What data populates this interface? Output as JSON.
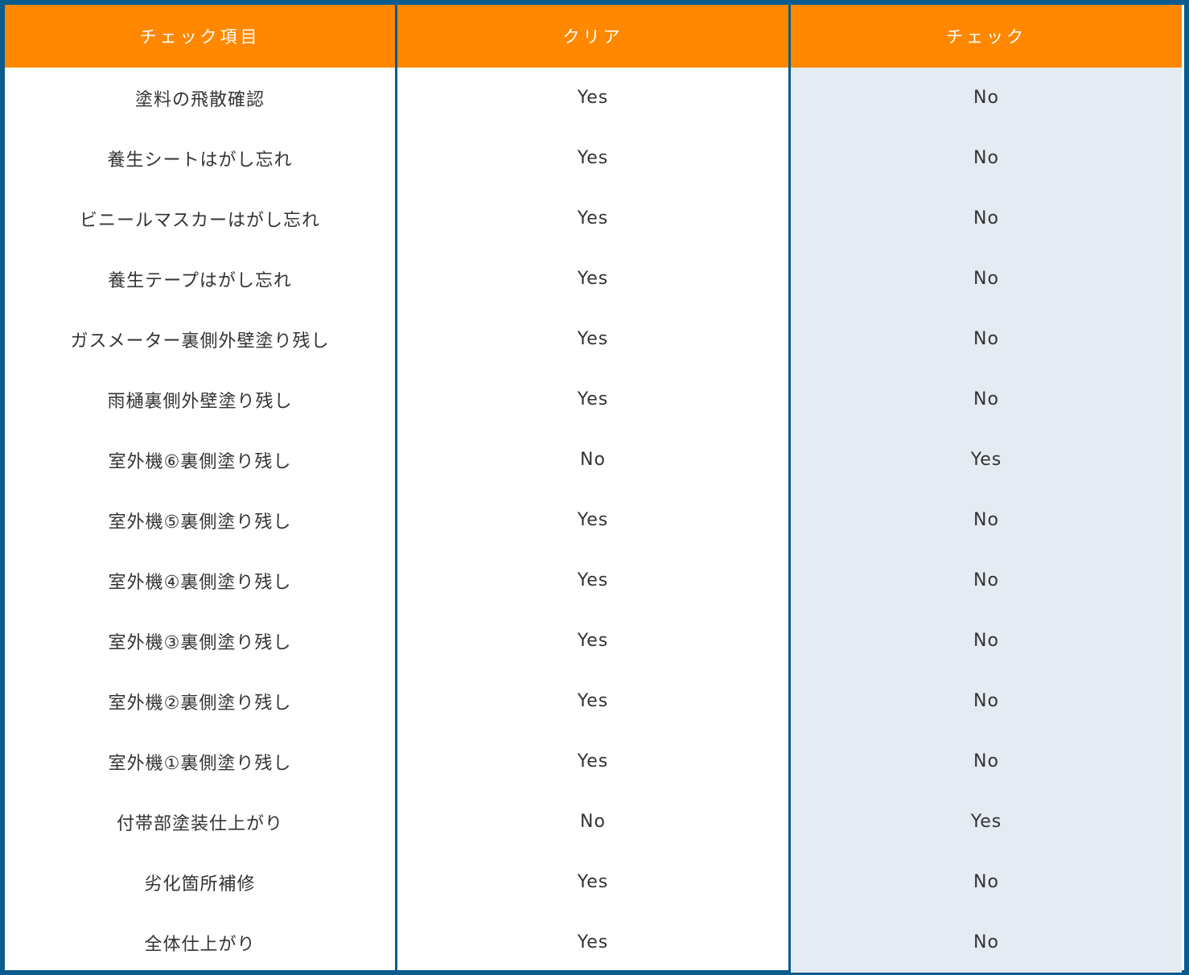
{
  "table": {
    "headers": {
      "item": "チェック項目",
      "clear": "クリア",
      "check": "チェック"
    },
    "rows": [
      {
        "item": "塗料の飛散確認",
        "clear": "Yes",
        "check": "No"
      },
      {
        "item": "養生シートはがし忘れ",
        "clear": "Yes",
        "check": "No"
      },
      {
        "item": "ビニールマスカーはがし忘れ",
        "clear": "Yes",
        "check": "No"
      },
      {
        "item": "養生テープはがし忘れ",
        "clear": "Yes",
        "check": "No"
      },
      {
        "item": "ガスメーター裏側外壁塗り残し",
        "clear": "Yes",
        "check": "No"
      },
      {
        "item": "雨樋裏側外壁塗り残し",
        "clear": "Yes",
        "check": "No"
      },
      {
        "item": "室外機⑥裏側塗り残し",
        "clear": "No",
        "check": "Yes"
      },
      {
        "item": "室外機⑤裏側塗り残し",
        "clear": "Yes",
        "check": "No"
      },
      {
        "item": "室外機④裏側塗り残し",
        "clear": "Yes",
        "check": "No"
      },
      {
        "item": "室外機③裏側塗り残し",
        "clear": "Yes",
        "check": "No"
      },
      {
        "item": "室外機②裏側塗り残し",
        "clear": "Yes",
        "check": "No"
      },
      {
        "item": "室外機①裏側塗り残し",
        "clear": "Yes",
        "check": "No"
      },
      {
        "item": "付帯部塗装仕上がり",
        "clear": "No",
        "check": "Yes"
      },
      {
        "item": "劣化箇所補修",
        "clear": "Yes",
        "check": "No"
      },
      {
        "item": "全体仕上がり",
        "clear": "Yes",
        "check": "No"
      }
    ]
  },
  "colors": {
    "header_bg": "#ff8800",
    "border": "#0b5b8f",
    "check_column_bg": "#e5ebf2",
    "text": "#333333"
  }
}
